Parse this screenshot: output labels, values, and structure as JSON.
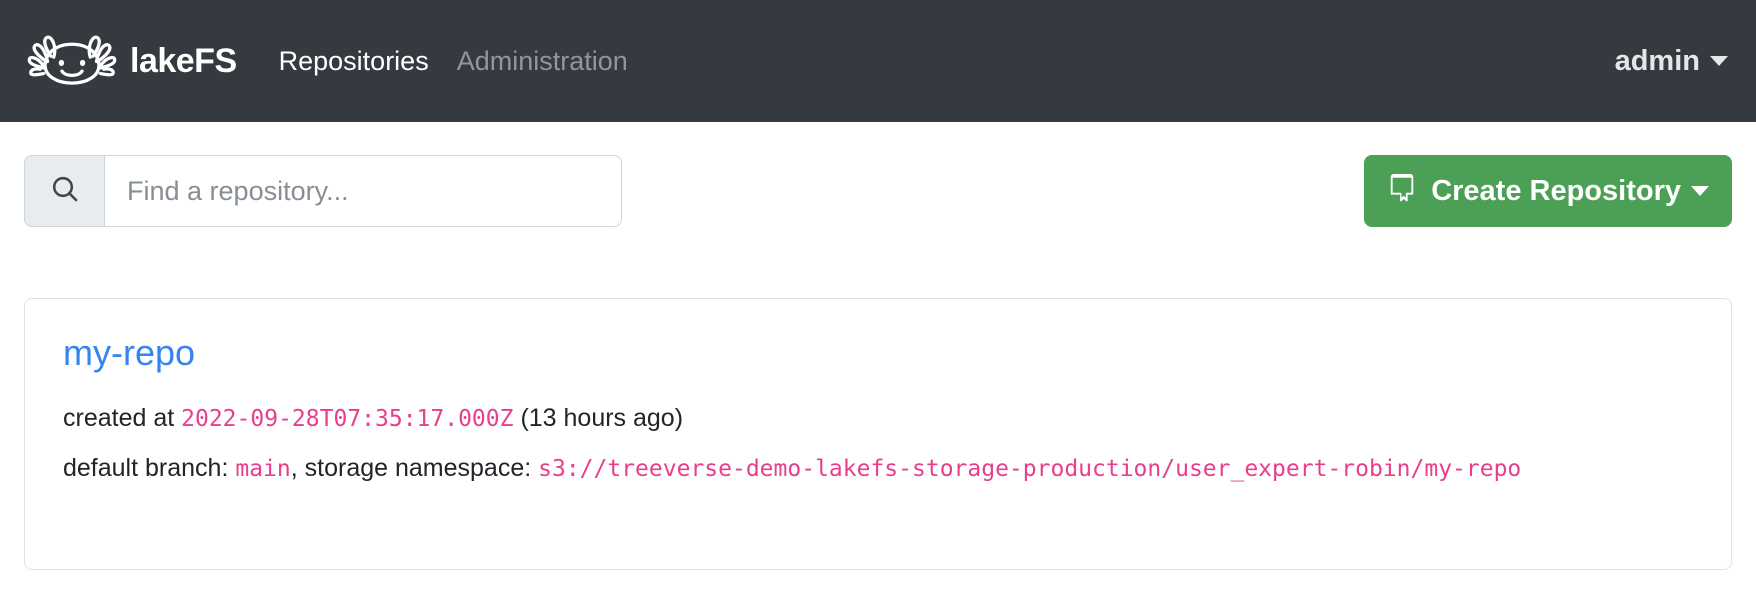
{
  "navbar": {
    "brand": {
      "logo_icon": "axolotl-logo-icon",
      "name": "lakeFS"
    },
    "links": [
      {
        "label": "Repositories",
        "state": "active"
      },
      {
        "label": "Administration",
        "state": "muted"
      }
    ],
    "user": {
      "label": "admin",
      "caret_icon": "chevron-down-icon"
    }
  },
  "toolbar": {
    "search": {
      "icon": "search-icon",
      "placeholder": "Find a repository...",
      "value": ""
    },
    "create_button": {
      "icon": "repo-icon",
      "label": "Create Repository",
      "caret_icon": "chevron-down-icon",
      "color": "#4ba055"
    }
  },
  "repositories": [
    {
      "name": "my-repo",
      "created_prefix": "created at",
      "created_at": "2022-09-28T07:35:17.000Z",
      "created_relative": "(13 hours ago)",
      "branch_prefix": "default branch:",
      "default_branch": "main",
      "namespace_prefix": ", storage namespace:",
      "storage_namespace": "s3://treeverse-demo-lakefs-storage-production/user_expert-robin/my-repo"
    }
  ],
  "colors": {
    "navbar_bg": "#343a40",
    "link_blue": "#3584f0",
    "code_pink": "#e83e8c",
    "green": "#4ba055"
  }
}
